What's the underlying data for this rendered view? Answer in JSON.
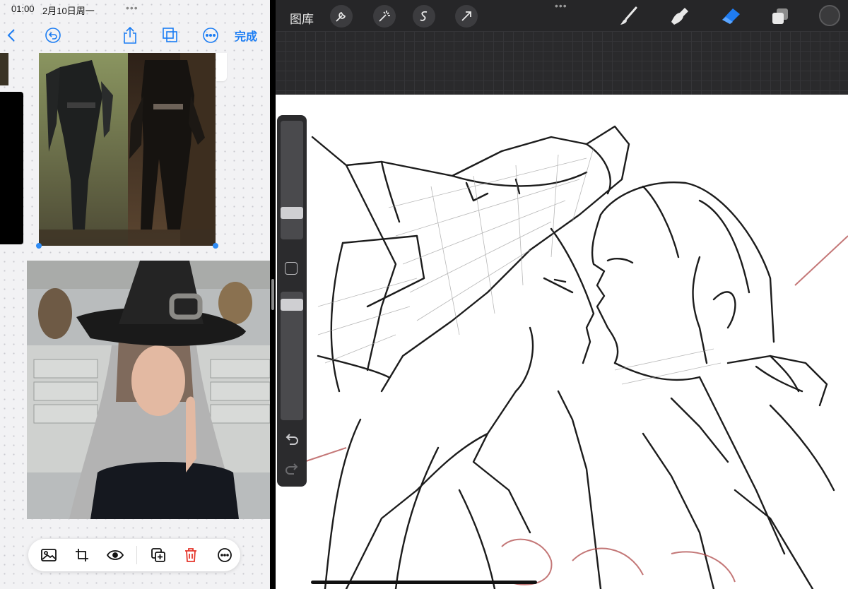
{
  "status": {
    "time": "01:00",
    "date": "2月10日周一"
  },
  "photos_editor": {
    "nav": {
      "back_icon": "chevron-left-icon",
      "revert_icon": "revert-icon",
      "share_icon": "share-icon",
      "duplicate_icon": "duplicate-icon",
      "more_icon": "ellipsis-icon",
      "done_label": "完成"
    },
    "toolbar": [
      "photo-icon",
      "crop-icon",
      "eye-icon",
      "duplicate-add-icon",
      "trash-icon",
      "ellipsis-icon"
    ],
    "accent": "#1a7cf3",
    "delete_color": "#e5362b"
  },
  "procreate": {
    "gallery_label": "图库",
    "left_tools": [
      "wrench-icon",
      "magic-wand-icon",
      "selection-icon",
      "transform-arrow-icon"
    ],
    "right_tools": [
      "brush-icon",
      "smudge-icon",
      "eraser-icon",
      "layers-icon",
      "color-swatch"
    ],
    "active_tool_color": "#1f7cf2",
    "sidebar": {
      "modify_icon": "square-icon",
      "undo_icon": "undo-icon",
      "redo_icon": "redo-icon"
    }
  }
}
